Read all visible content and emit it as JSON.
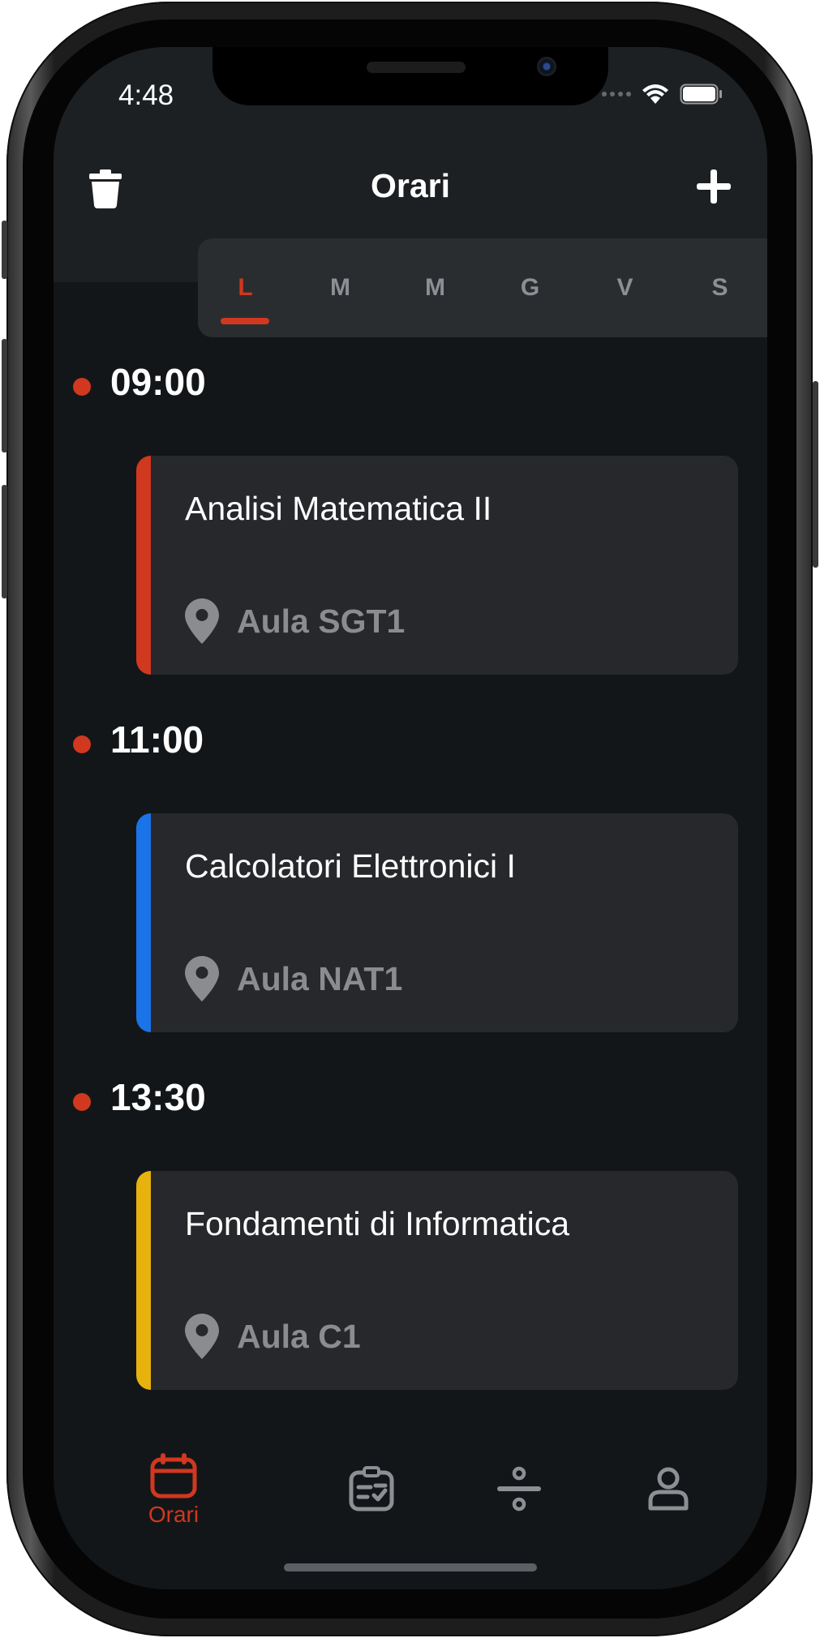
{
  "status": {
    "time": "4:48"
  },
  "header": {
    "title": "Orari"
  },
  "days": [
    {
      "label": "L",
      "active": true
    },
    {
      "label": "M",
      "active": false
    },
    {
      "label": "M",
      "active": false
    },
    {
      "label": "G",
      "active": false
    },
    {
      "label": "V",
      "active": false
    },
    {
      "label": "S",
      "active": false
    }
  ],
  "schedule": [
    {
      "time": "09:00",
      "course": "Analisi Matematica II",
      "room": "Aula SGT1",
      "color": "#d0381f"
    },
    {
      "time": "11:00",
      "course": "Calcolatori Elettronici I",
      "room": "Aula NAT1",
      "color": "#1a74e8"
    },
    {
      "time": "13:30",
      "course": "Fondamenti di Informatica",
      "room": "Aula C1",
      "color": "#e8b20e"
    }
  ],
  "tabs": [
    {
      "label": "Orari",
      "icon": "calendar-icon",
      "active": true
    },
    {
      "label": "",
      "icon": "clipboard-checklist-icon",
      "active": false
    },
    {
      "label": "",
      "icon": "divide-icon",
      "active": false
    },
    {
      "label": "",
      "icon": "user-icon",
      "active": false
    }
  ],
  "colors": {
    "accent": "#d0381f",
    "background": "#131618",
    "card": "#26282b"
  }
}
